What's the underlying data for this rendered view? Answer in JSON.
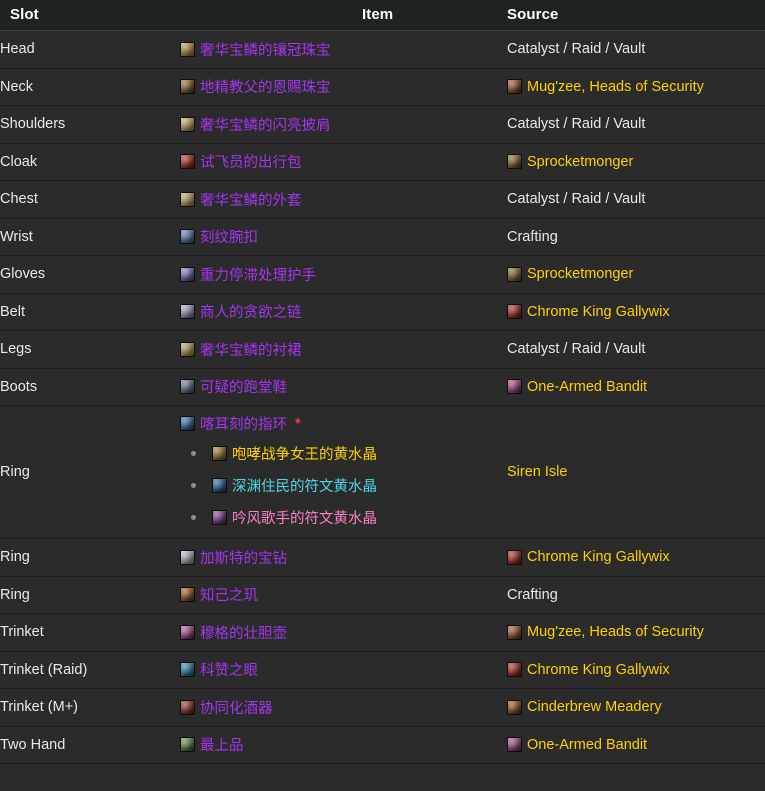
{
  "table": {
    "columns": [
      "Slot",
      "Item",
      "Source"
    ],
    "rows": [
      {
        "slot": "Head",
        "item": {
          "name": "奢华宝鳞的镶冠珠宝",
          "quality": "epic",
          "icon": "helm-icon",
          "icon_colors": [
            "#c9a84c",
            "#6b5421"
          ]
        },
        "source": {
          "name": "Catalyst / Raid / Vault",
          "style": "plain",
          "icon": null
        }
      },
      {
        "slot": "Neck",
        "item": {
          "name": "地精教父的恩赐珠宝",
          "quality": "epic",
          "icon": "amulet-icon",
          "icon_colors": [
            "#b07a38",
            "#3a2412"
          ]
        },
        "source": {
          "name": "Mug'zee, Heads of Security",
          "style": "gold",
          "icon": "boss-mugzee-icon",
          "icon_colors": [
            "#b4603a",
            "#4a2113"
          ]
        }
      },
      {
        "slot": "Shoulders",
        "item": {
          "name": "奢华宝鳞的闪亮披肩",
          "quality": "epic",
          "icon": "shoulder-icon",
          "icon_colors": [
            "#d6c07a",
            "#6a5a2c"
          ]
        },
        "source": {
          "name": "Catalyst / Raid / Vault",
          "style": "plain",
          "icon": null
        }
      },
      {
        "slot": "Cloak",
        "item": {
          "name": "试飞员的出行包",
          "quality": "epic",
          "icon": "cloak-icon",
          "icon_colors": [
            "#c8392f",
            "#5a1a14"
          ]
        },
        "source": {
          "name": "Sprocketmonger",
          "style": "gold",
          "icon": "boss-sprocketmonger-icon",
          "icon_colors": [
            "#9a7a3c",
            "#3d2f14"
          ]
        }
      },
      {
        "slot": "Chest",
        "item": {
          "name": "奢华宝鳞的外套",
          "quality": "epic",
          "icon": "chest-icon",
          "icon_colors": [
            "#d3bd78",
            "#6b5a2a"
          ]
        },
        "source": {
          "name": "Catalyst / Raid / Vault",
          "style": "plain",
          "icon": null
        }
      },
      {
        "slot": "Wrist",
        "item": {
          "name": "刻纹腕扣",
          "quality": "epic",
          "icon": "bracer-icon",
          "icon_colors": [
            "#6c8ec4",
            "#2a3c5c"
          ]
        },
        "source": {
          "name": "Crafting",
          "style": "plain",
          "icon": null
        }
      },
      {
        "slot": "Gloves",
        "item": {
          "name": "重力停滞处理护手",
          "quality": "epic",
          "icon": "gloves-icon",
          "icon_colors": [
            "#8e8fd0",
            "#2e2f57"
          ]
        },
        "source": {
          "name": "Sprocketmonger",
          "style": "gold",
          "icon": "boss-sprocketmonger-icon",
          "icon_colors": [
            "#9a7a3c",
            "#3d2f14"
          ]
        }
      },
      {
        "slot": "Belt",
        "item": {
          "name": "商人的贪欲之链",
          "quality": "epic",
          "icon": "belt-icon",
          "icon_colors": [
            "#b9bdd4",
            "#4a4d61"
          ]
        },
        "source": {
          "name": "Chrome King Gallywix",
          "style": "gold",
          "icon": "boss-gallywix-icon",
          "icon_colors": [
            "#c2352b",
            "#581510"
          ]
        }
      },
      {
        "slot": "Legs",
        "item": {
          "name": "奢华宝鳞的衬裙",
          "quality": "epic",
          "icon": "legs-icon",
          "icon_colors": [
            "#cdb873",
            "#63532a"
          ]
        },
        "source": {
          "name": "Catalyst / Raid / Vault",
          "style": "plain",
          "icon": null
        }
      },
      {
        "slot": "Boots",
        "item": {
          "name": "可疑的跑堂鞋",
          "quality": "epic",
          "icon": "boots-icon",
          "icon_colors": [
            "#7d8ba6",
            "#313a4c"
          ]
        },
        "source": {
          "name": "One-Armed Bandit",
          "style": "gold",
          "icon": "boss-bandit-icon",
          "icon_colors": [
            "#c05a9a",
            "#4c1b3a"
          ]
        }
      },
      {
        "slot": "Ring",
        "item": {
          "name": "喀耳刻的指环",
          "quality": "epic",
          "icon": "ring-icon",
          "icon_colors": [
            "#3f7ec9",
            "#18304f"
          ],
          "asterisk": "*",
          "sub_items": [
            {
              "name": "咆哮战争女王的黄水晶",
              "quality": "gold",
              "icon": "gem-citrine-gold-icon",
              "icon_colors": [
                "#b8902e",
                "#4c3a10"
              ]
            },
            {
              "name": "深渊住民的符文黄水晶",
              "quality": "cyan",
              "icon": "gem-citrine-cyan-icon",
              "icon_colors": [
                "#2f6fae",
                "#123049"
              ]
            },
            {
              "name": "吟风歌手的符文黄水晶",
              "quality": "pink",
              "icon": "gem-citrine-pink-icon",
              "icon_colors": [
                "#8f4aa8",
                "#3c1b48"
              ]
            }
          ]
        },
        "source": {
          "name": "Siren Isle",
          "style": "gold",
          "icon": null
        }
      },
      {
        "slot": "Ring",
        "item": {
          "name": "加斯特的宝钻",
          "quality": "epic",
          "icon": "ring-diamond-icon",
          "icon_colors": [
            "#cfd4dd",
            "#585c68"
          ]
        },
        "source": {
          "name": "Chrome King Gallywix",
          "style": "gold",
          "icon": "boss-gallywix-icon",
          "icon_colors": [
            "#c2352b",
            "#581510"
          ]
        }
      },
      {
        "slot": "Ring",
        "item": {
          "name": "知己之玑",
          "quality": "epic",
          "icon": "ring-crafted-icon",
          "icon_colors": [
            "#c06a2a",
            "#4e2710"
          ]
        },
        "source": {
          "name": "Crafting",
          "style": "plain",
          "icon": null
        }
      },
      {
        "slot": "Trinket",
        "item": {
          "name": "穆格的壮胆壶",
          "quality": "epic",
          "icon": "trinket-flask-icon",
          "icon_colors": [
            "#d05fb0",
            "#4e1a42"
          ]
        },
        "source": {
          "name": "Mug'zee, Heads of Security",
          "style": "gold",
          "icon": "boss-mugzee-icon",
          "icon_colors": [
            "#b4603a",
            "#4a2113"
          ]
        }
      },
      {
        "slot": "Trinket (Raid)",
        "item": {
          "name": "科赞之眼",
          "quality": "epic",
          "icon": "trinket-eye-icon",
          "icon_colors": [
            "#3e9bc6",
            "#153c50"
          ]
        },
        "source": {
          "name": "Chrome King Gallywix",
          "style": "gold",
          "icon": "boss-gallywix-icon",
          "icon_colors": [
            "#c2352b",
            "#581510"
          ]
        }
      },
      {
        "slot": "Trinket (M+)",
        "item": {
          "name": "协同化酒器",
          "quality": "epic",
          "icon": "trinket-keg-icon",
          "icon_colors": [
            "#a33f2e",
            "#421511"
          ]
        },
        "source": {
          "name": "Cinderbrew Meadery",
          "style": "gold",
          "icon": "dungeon-cinderbrew-icon",
          "icon_colors": [
            "#b06a2c",
            "#431f0e"
          ]
        }
      },
      {
        "slot": "Two Hand",
        "item": {
          "name": "最上品",
          "quality": "epic",
          "icon": "weapon-twohand-icon",
          "icon_colors": [
            "#6f9d57",
            "#2a3d1f"
          ]
        },
        "source": {
          "name": "One-Armed Bandit",
          "style": "gold",
          "icon": "boss-bandit-icon",
          "icon_colors": [
            "#c05a9a",
            "#4c1b3a"
          ]
        }
      }
    ]
  },
  "colors": {
    "epic": "#a335ee",
    "gold": "#ffd100",
    "cyan": "#4fd6e8",
    "pink": "#ff7fc4",
    "plain_text": "#e9e9e9",
    "asterisk": "#e4403a",
    "header_bg": "#1c2321",
    "row_bg": "#2b2b2b",
    "divider": "#1d1d1d"
  }
}
